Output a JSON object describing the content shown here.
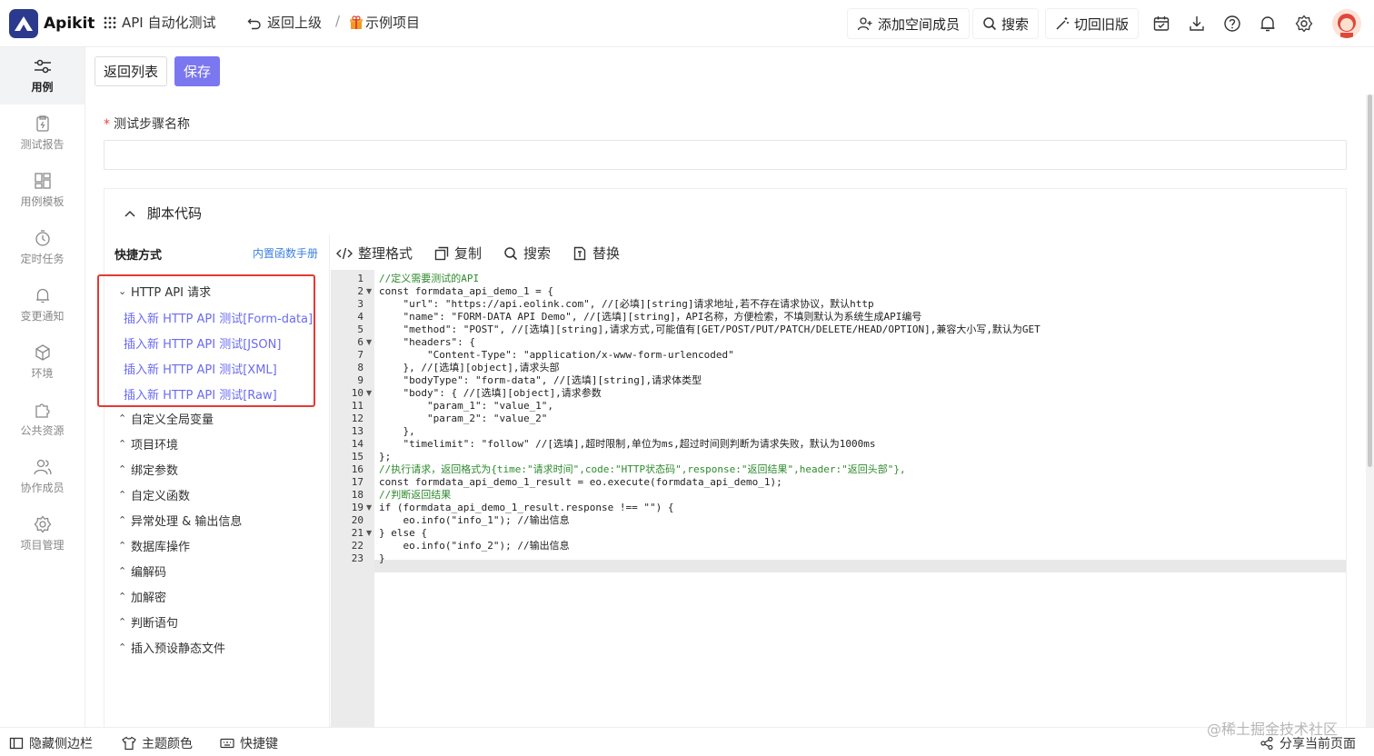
{
  "app": {
    "name": "Apikit"
  },
  "topbar": {
    "project": "API 自动化测试",
    "back": "返回上级",
    "separator": "/",
    "example": "示例项目",
    "add_member": "添加空间成员",
    "search": "搜索",
    "switch_old": "切回旧版"
  },
  "sidebar": {
    "items": [
      {
        "label": "用例",
        "icon": "sliders-icon"
      },
      {
        "label": "测试报告",
        "icon": "report-icon"
      },
      {
        "label": "用例模板",
        "icon": "template-icon"
      },
      {
        "label": "定时任务",
        "icon": "timer-icon"
      },
      {
        "label": "变更通知",
        "icon": "bell-icon"
      },
      {
        "label": "环境",
        "icon": "cube-icon"
      },
      {
        "label": "公共资源",
        "icon": "puzzle-icon"
      },
      {
        "label": "协作成员",
        "icon": "members-icon"
      },
      {
        "label": "项目管理",
        "icon": "gear-icon"
      }
    ]
  },
  "actions": {
    "back_list": "返回列表",
    "save": "保存"
  },
  "form": {
    "required_mark": "*",
    "step_name_label": "测试步骤名称",
    "step_name_value": ""
  },
  "script": {
    "title": "脚本代码",
    "quick_title": "快捷方式",
    "builtin_link": "内置函数手册",
    "http_group": "HTTP API 请求",
    "http_items": [
      "插入新 HTTP API 测试[Form-data]",
      "插入新 HTTP API 测试[JSON]",
      "插入新 HTTP API 测试[XML]",
      "插入新 HTTP API 测试[Raw]"
    ],
    "groups": [
      "自定义全局变量",
      "项目环境",
      "绑定参数",
      "自定义函数",
      "异常处理 & 输出信息",
      "数据库操作",
      "编解码",
      "加解密",
      "判断语句",
      "插入预设静态文件"
    ],
    "toolbar": {
      "format": "整理格式",
      "copy": "复制",
      "search": "搜索",
      "replace": "替换"
    }
  },
  "code": {
    "lines": [
      "//定义需要测试的API",
      "const formdata_api_demo_1 = {",
      "    \"url\": \"https://api.eolink.com\", //[必填][string]请求地址,若不存在请求协议，默认http",
      "    \"name\": \"FORM-DATA API Demo\", //[选填][string]，API名称，方便检索，不填则默认为系统生成API编号",
      "    \"method\": \"POST\", //[选填][string],请求方式,可能值有[GET/POST/PUT/PATCH/DELETE/HEAD/OPTION],兼容大小写,默认为GET",
      "    \"headers\": {",
      "        \"Content-Type\": \"application/x-www-form-urlencoded\"",
      "    }, //[选填][object],请求头部",
      "    \"bodyType\": \"form-data\", //[选填][string],请求体类型",
      "    \"body\": { //[选填][object],请求参数",
      "        \"param_1\": \"value_1\",",
      "        \"param_2\": \"value_2\"",
      "    },",
      "    \"timelimit\": \"follow\" //[选填],超时限制,单位为ms,超过时间则判断为请求失败，默认为1000ms",
      "};",
      "//执行请求，返回格式为{time:\"请求时间\",code:\"HTTP状态码\",response:\"返回结果\",header:\"返回头部\"},",
      "const formdata_api_demo_1_result = eo.execute(formdata_api_demo_1);",
      "//判断返回结果",
      "if (formdata_api_demo_1_result.response !== \"\") {",
      "    eo.info(\"info_1\"); //输出信息",
      "} else {",
      "    eo.info(\"info_2\"); //输出信息",
      "}"
    ]
  },
  "bottombar": {
    "hide_sidebar": "隐藏侧边栏",
    "theme": "主题颜色",
    "shortcuts": "快捷键",
    "share": "分享当前页面",
    "watermark": "@稀土掘金技术社区"
  }
}
